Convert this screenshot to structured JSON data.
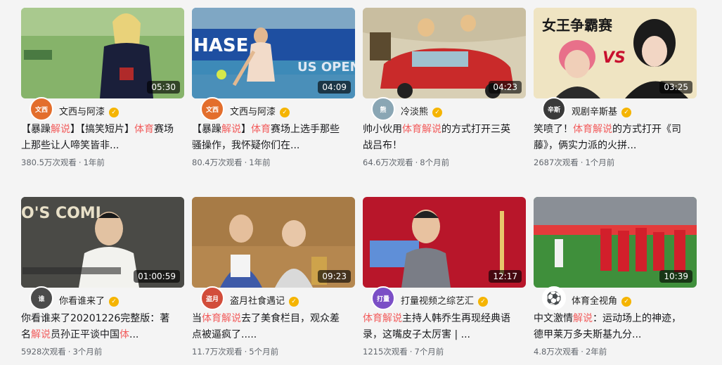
{
  "cards": [
    {
      "duration": "05:30",
      "author": "文西与阿漆",
      "avatar_text": "文西",
      "title_parts": [
        "【暴躁",
        "解说",
        "】【搞笑短片】",
        "体育",
        "赛场上那些让人啼笑皆非..."
      ],
      "views": "380.5万次观看",
      "time": "1年前"
    },
    {
      "duration": "04:09",
      "author": "文西与阿漆",
      "avatar_text": "文西",
      "title_parts": [
        "【暴躁",
        "解说",
        "】",
        "体育",
        "赛场上选手那些骚操作，我怀疑你们在..."
      ],
      "views": "80.4万次观看",
      "time": "1年前"
    },
    {
      "duration": "04:23",
      "author": "冷淡熊",
      "avatar_text": "熊",
      "title_parts": [
        "帅小伙用",
        "体育解说",
        "的方式打开三英战吕布！"
      ],
      "views": "64.6万次观看",
      "time": "8个月前"
    },
    {
      "duration": "03:25",
      "author": "观剧辛斯基",
      "avatar_text": "辛斯",
      "title_parts": [
        "笑喷了！",
        "体育解说",
        "的方式打开《司藤》，俩实力派的火拼..."
      ],
      "views": "2687次观看",
      "time": "1个月前"
    },
    {
      "duration": "01:00:59",
      "author": "你看谁来了",
      "avatar_text": "谁",
      "title_parts": [
        "你看谁来了20201226完整版：著名",
        "解说",
        "员孙正平谈中国",
        "体",
        "..."
      ],
      "views": "5928次观看",
      "time": "3个月前"
    },
    {
      "duration": "09:23",
      "author": "盗月社食遇记",
      "avatar_text": "盗月",
      "title_parts": [
        "当",
        "体育解说",
        "去了美食栏目，观众差点被逼疯了....."
      ],
      "views": "11.7万次观看",
      "time": "5个月前"
    },
    {
      "duration": "12:17",
      "author": "打量视频之综艺汇",
      "avatar_text": "打量",
      "title_parts": [
        "",
        "体育解说",
        "主持人韩乔生再现经典语录，这嘴皮子太厉害 | ..."
      ],
      "views": "1215次观看",
      "time": "7个月前"
    },
    {
      "duration": "10:39",
      "author": "体育全视角",
      "avatar_text": "⚽",
      "title_parts": [
        "中文激情",
        "解说",
        "：运动场上的神迹，德甲莱万多夫斯基九分..."
      ],
      "views": "4.8万次观看",
      "time": "2年前"
    }
  ],
  "thumb_text": {
    "card2_banner": "HASE",
    "card2_banner2": "US OPEN",
    "card4_title": "女王争霸赛",
    "card4_vs": "VS",
    "card5_logo": "O'S COMI"
  },
  "colors": {
    "highlight": "#f25d5d",
    "verified_badge": "#f5b400"
  }
}
